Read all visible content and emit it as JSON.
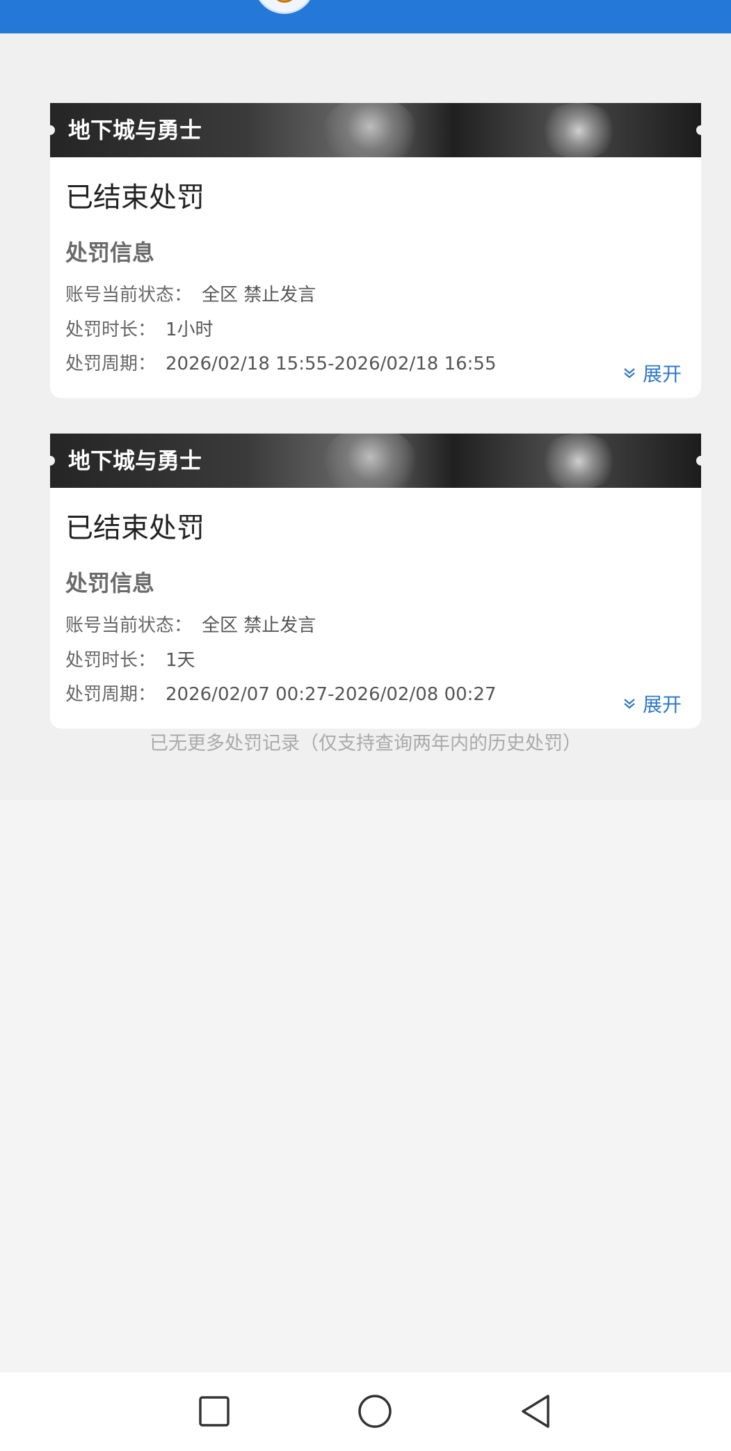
{
  "cards": [
    {
      "game_title": "地下城与勇士",
      "status": "已结束处罚",
      "section_title": "处罚信息",
      "rows": [
        {
          "label": "账号当前状态：",
          "value": "全区 禁止发言"
        },
        {
          "label": "处罚时长：",
          "value": "1小时"
        },
        {
          "label": "处罚周期：",
          "value": "2026/02/18 15:55-2026/02/18 16:55"
        }
      ],
      "expand_label": "展开"
    },
    {
      "game_title": "地下城与勇士",
      "status": "已结束处罚",
      "section_title": "处罚信息",
      "rows": [
        {
          "label": "账号当前状态：",
          "value": "全区 禁止发言"
        },
        {
          "label": "处罚时长：",
          "value": "1天"
        },
        {
          "label": "处罚周期：",
          "value": "2026/02/07 00:27-2026/02/08 00:27"
        }
      ],
      "expand_label": "展开"
    }
  ],
  "end_note": "已无更多处罚记录（仅支持查询两年内的历史处罚）",
  "colors": {
    "header_blue": "#2478d8",
    "link_blue": "#2f78c9",
    "page_bg": "#f4f4f4"
  },
  "icons": {
    "expand": "double-chevron-down-icon",
    "nav_recent": "square-icon",
    "nav_home": "circle-icon",
    "nav_back": "triangle-back-icon"
  }
}
